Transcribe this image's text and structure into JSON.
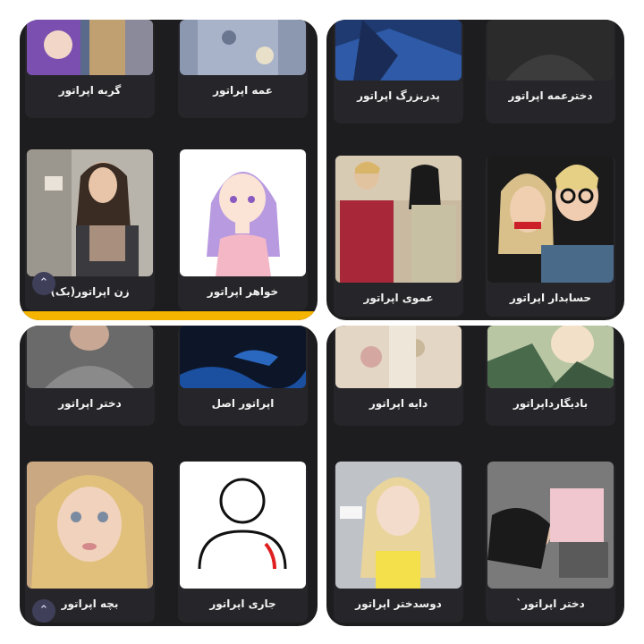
{
  "panels": [
    {
      "cards": [
        {
          "label": "گربه اپراتور"
        },
        {
          "label": "عمه اپراتور"
        },
        {
          "label": "زن اپراتور(بک)"
        },
        {
          "label": "خواهر اپراتور"
        }
      ],
      "scroll_icon": "chevron-up-icon"
    },
    {
      "cards": [
        {
          "label": "پدربزرگ اپراتور"
        },
        {
          "label": "دخترعمه اپراتور"
        },
        {
          "label": "عموی اپراتور"
        },
        {
          "label": "حسابدار اپراتور"
        }
      ]
    },
    {
      "cards": [
        {
          "label": "دختر اپراتور"
        },
        {
          "label": "اپراتور اصل"
        },
        {
          "label": "بچه اپراتور"
        },
        {
          "label": "جاری اپراتور"
        }
      ],
      "scroll_icon": "chevron-up-icon"
    },
    {
      "cards": [
        {
          "label": "دایه اپراتور"
        },
        {
          "label": "بادیگارداپراتور"
        },
        {
          "label": "دوسدختر اپراتور"
        },
        {
          "label": "دختر اپراتور`"
        }
      ]
    }
  ],
  "colors": {
    "panel_bg": "#1d1d1f",
    "card_bg": "#26262a",
    "accent_yellow": "#f5b400",
    "scroll_button": "#3f3f5a"
  }
}
